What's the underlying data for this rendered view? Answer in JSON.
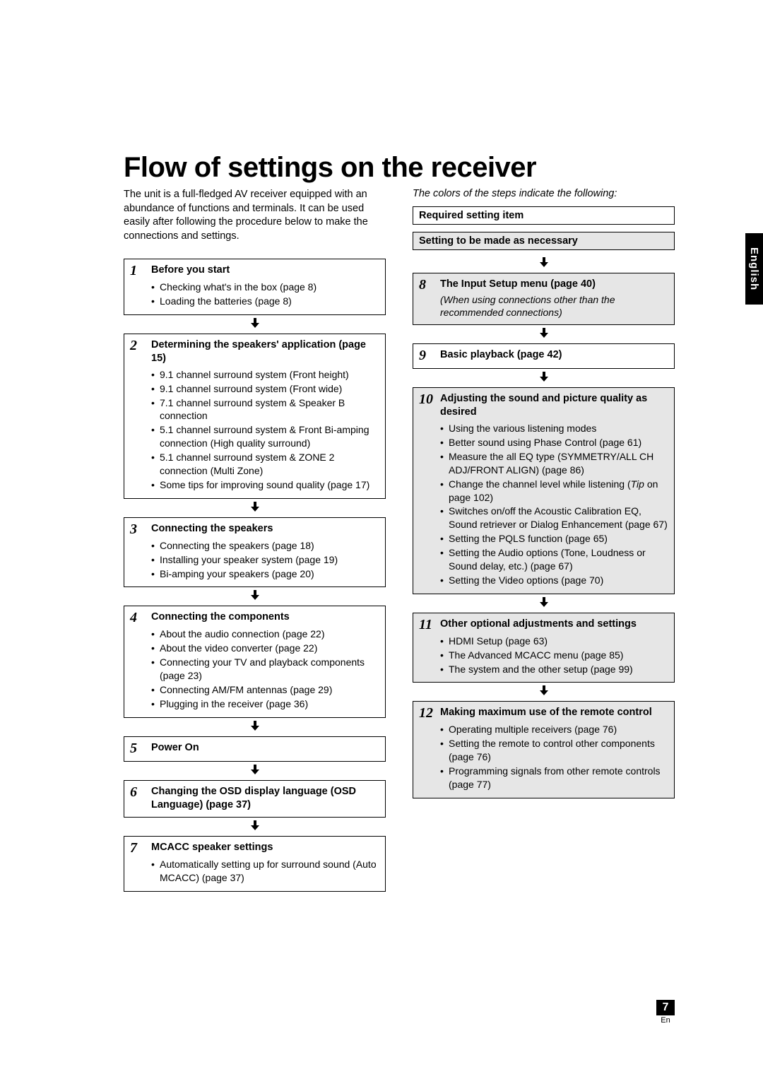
{
  "title": "Flow of settings on the receiver",
  "intro": "The unit is a full-fledged AV receiver equipped with an abundance of functions and terminals. It can be used easily after following the procedure below to make the connections and settings.",
  "legend": {
    "intro": "The colors of the steps indicate the following:",
    "required": "Required setting item",
    "optional": "Setting to be made as necessary"
  },
  "side_tab": "English",
  "page_number": "7",
  "page_lang": "En",
  "steps_left": [
    {
      "num": "1",
      "type": "required",
      "title": "Before you start",
      "bullets": [
        "Checking what's in the box (page 8)",
        "Loading the batteries (page 8)"
      ]
    },
    {
      "num": "2",
      "type": "required",
      "title": "Determining the speakers' application (page 15)",
      "bullets": [
        "9.1 channel surround system (Front height)",
        "9.1 channel surround system (Front wide)",
        "7.1 channel surround system & Speaker B connection",
        "5.1 channel surround system & Front Bi-amping connection (High quality surround)",
        "5.1 channel surround system & ZONE 2 connection (Multi Zone)",
        "Some tips for improving sound quality (page 17)"
      ]
    },
    {
      "num": "3",
      "type": "required",
      "title": "Connecting the speakers",
      "bullets": [
        "Connecting the speakers (page 18)",
        "Installing your speaker system (page 19)",
        "Bi-amping your speakers (page 20)"
      ]
    },
    {
      "num": "4",
      "type": "required",
      "title": "Connecting the components",
      "bullets": [
        "About the audio connection (page 22)",
        "About the video converter (page 22)",
        "Connecting your TV and playback components (page 23)",
        "Connecting AM/FM antennas (page 29)",
        "Plugging in the receiver (page 36)"
      ]
    },
    {
      "num": "5",
      "type": "required",
      "title": "Power On",
      "bullets": []
    },
    {
      "num": "6",
      "type": "required",
      "title": "Changing the OSD display language (OSD Language) (page 37)",
      "bullets": []
    },
    {
      "num": "7",
      "type": "required",
      "title": "MCACC speaker settings",
      "bullets": [
        "Automatically setting up for surround sound (Auto MCACC) (page 37)"
      ]
    }
  ],
  "steps_right": [
    {
      "num": "8",
      "type": "optional",
      "title": "The Input Setup menu (page 40)",
      "note": "(When using connections other than the recommended connections)",
      "bullets": []
    },
    {
      "num": "9",
      "type": "required",
      "title": "Basic playback (page 42)",
      "bullets": []
    },
    {
      "num": "10",
      "type": "optional",
      "title": "Adjusting the sound and picture quality as desired",
      "bullets": [
        "Using the various listening modes",
        "Better sound using Phase Control (page 61)",
        "Measure the all EQ type (SYMMETRY/ALL CH ADJ/FRONT ALIGN) (page 86)",
        "Change the channel level while listening (<i>Tip</i> on page 102)",
        "Switches on/off the Acoustic Calibration EQ, Sound retriever or Dialog Enhancement (page 67)",
        "Setting the PQLS function (page 65)",
        "Setting the Audio options (Tone, Loudness or Sound delay, etc.) (page 67)",
        "Setting the Video options (page 70)"
      ]
    },
    {
      "num": "11",
      "type": "optional",
      "title": "Other optional adjustments and settings",
      "bullets": [
        "HDMI Setup (page 63)",
        "The Advanced MCACC menu (page 85)",
        "The system and the other setup (page 99)"
      ]
    },
    {
      "num": "12",
      "type": "optional",
      "title": "Making maximum use of the remote control",
      "bullets": [
        "Operating multiple receivers (page 76)",
        "Setting the remote to control other components (page 76)",
        "Programming signals from other remote controls (page 77)"
      ]
    }
  ]
}
